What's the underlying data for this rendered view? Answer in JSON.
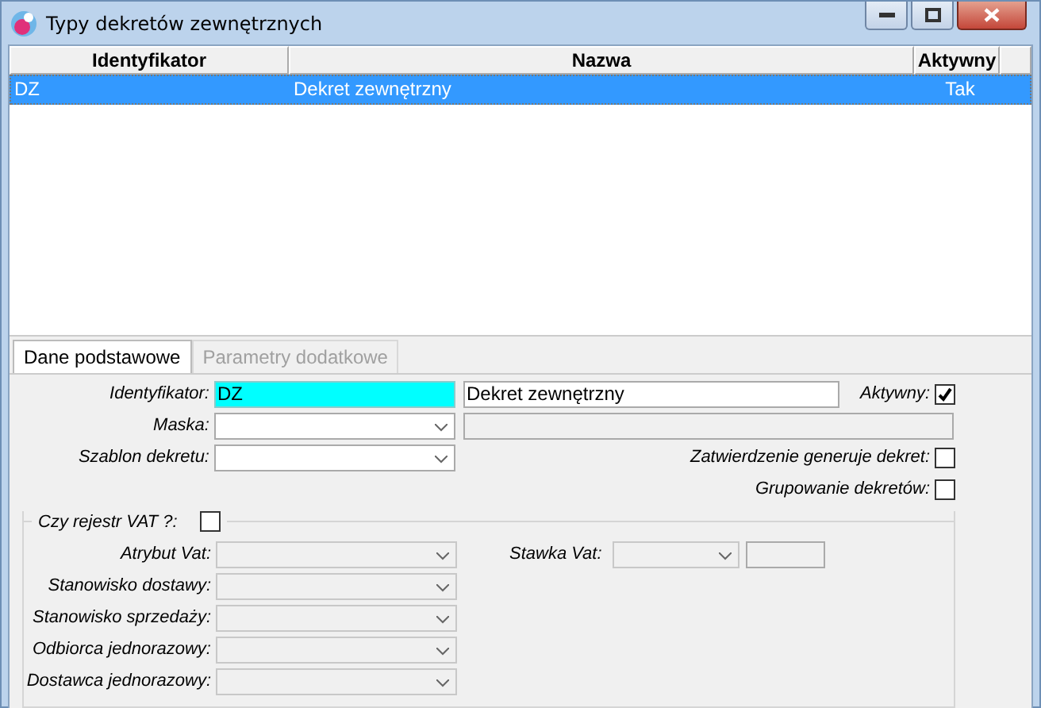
{
  "window": {
    "title": "Typy dekretów zewnętrznych"
  },
  "table": {
    "columns": [
      "Identyfikator",
      "Nazwa",
      "Aktywny"
    ],
    "rows": [
      {
        "cells": [
          "DZ",
          "Dekret zewnętrzny",
          "Tak"
        ],
        "selected": true
      }
    ]
  },
  "tabs": [
    {
      "label": "Dane podstawowe",
      "selected": true,
      "disabled": false
    },
    {
      "label": "Parametry dodatkowe",
      "selected": false,
      "disabled": true
    }
  ],
  "form": {
    "identifier": {
      "label": "Identyfikator:",
      "value": "DZ"
    },
    "name": {
      "value": "Dekret zewnętrzny"
    },
    "active": {
      "label": "Aktywny:",
      "checked": true
    },
    "mask": {
      "label": "Maska:",
      "disabled": false
    },
    "template": {
      "label": "Szablon dekretu:",
      "disabled": false
    },
    "approval": {
      "label": "Zatwierdzenie generuje dekret:",
      "checked": false
    },
    "grouping": {
      "label": "Grupowanie dekretów:",
      "checked": false
    }
  },
  "vat": {
    "label": "Czy rejestr VAT ?:",
    "checked": false,
    "fields": [
      {
        "label": "Atrybut Vat:",
        "disabled": true
      },
      {
        "label": "Stanowisko dostawy:",
        "disabled": true
      },
      {
        "label": "Stanowisko sprzedaży:",
        "disabled": true
      },
      {
        "label": "Odbiorca jednorazowy:",
        "disabled": true
      },
      {
        "label": "Dostawca jednorazowy:",
        "disabled": true
      }
    ],
    "rate": {
      "label": "Stawka Vat:",
      "disabled": true
    }
  }
}
